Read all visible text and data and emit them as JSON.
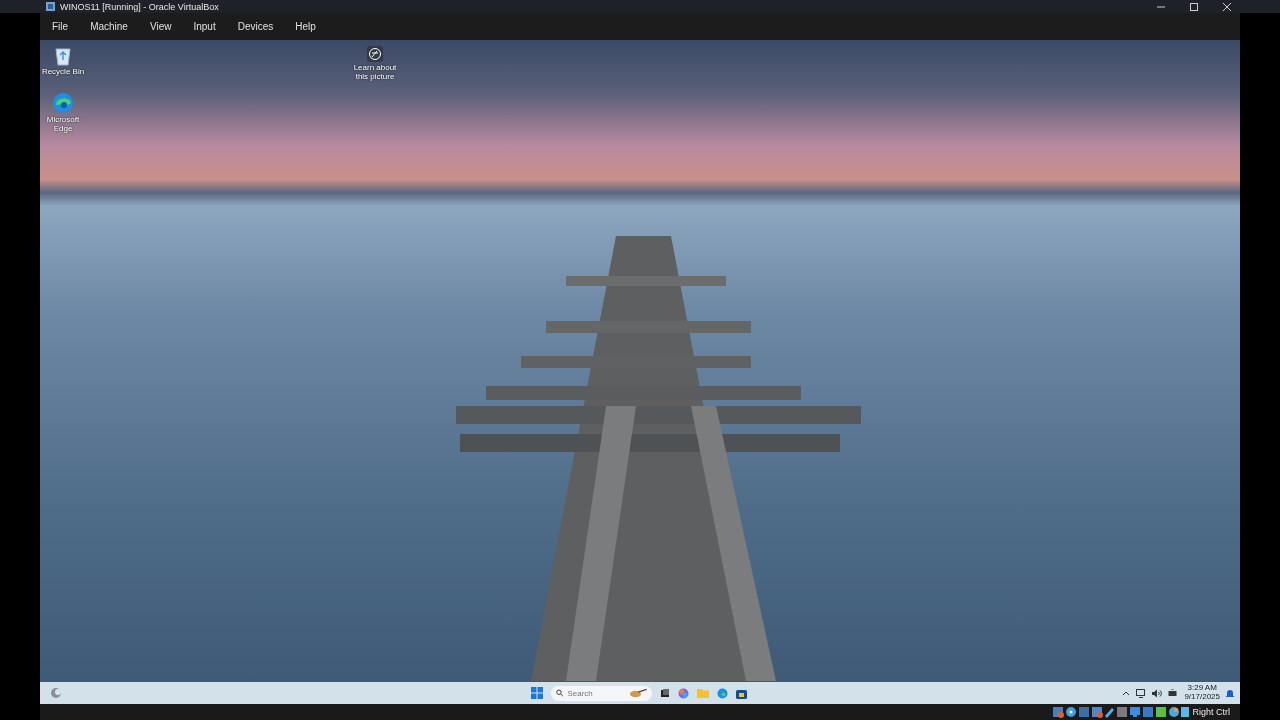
{
  "window": {
    "title": "WINOS11 [Running] - Oracle VirtualBox"
  },
  "menu": [
    "File",
    "Machine",
    "View",
    "Input",
    "Devices",
    "Help"
  ],
  "desktop_icons": [
    {
      "kind": "recycle",
      "label": "Recycle Bin"
    },
    {
      "kind": "edge",
      "label": "Microsoft Edge"
    }
  ],
  "wallpaper_info": {
    "label": "Learn about this picture"
  },
  "taskbar": {
    "search": {
      "placeholder": "Search"
    },
    "clock": {
      "time": "3:29 AM",
      "date": "9/17/2025"
    }
  },
  "status_bar": {
    "host_key": "Right Ctrl"
  }
}
